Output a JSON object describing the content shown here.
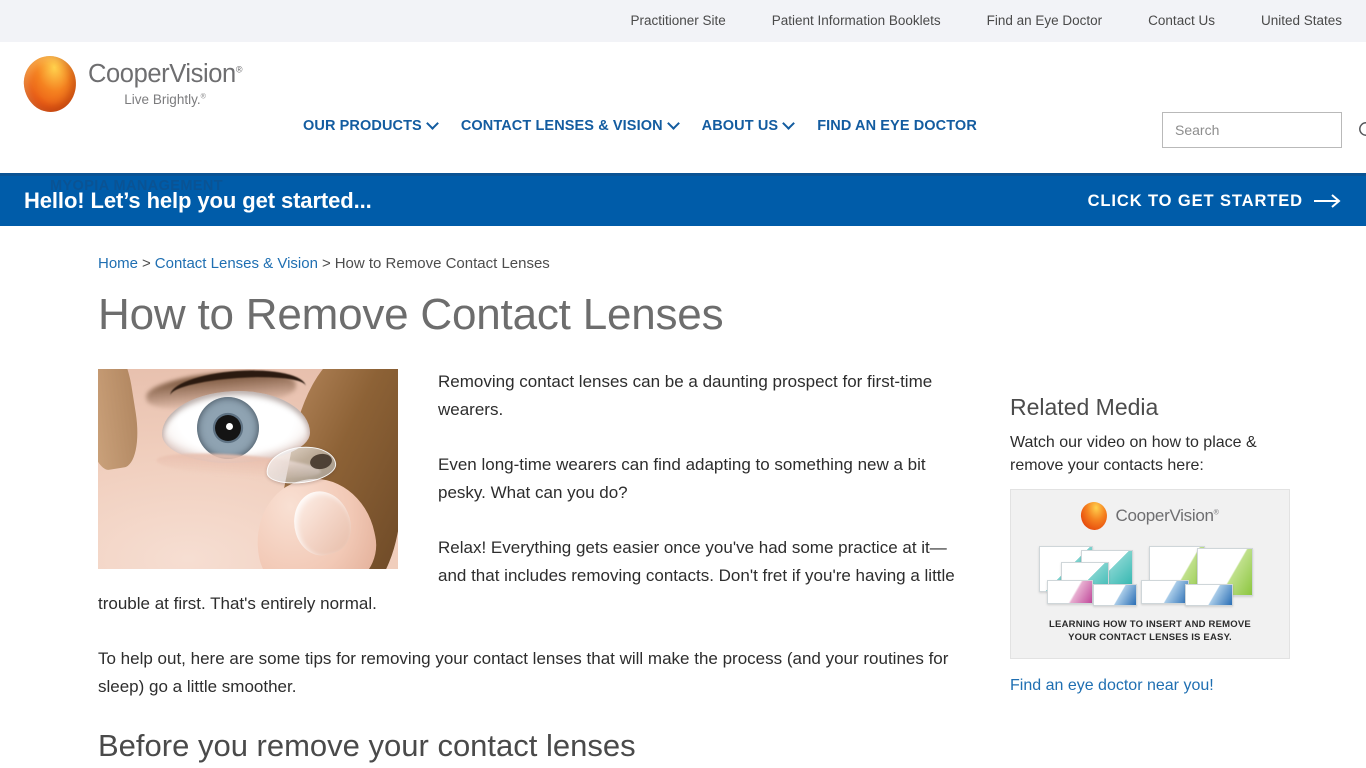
{
  "utility_bar": {
    "links": [
      {
        "label": "Practitioner Site",
        "name": "practitioner-site"
      },
      {
        "label": "Patient Information Booklets",
        "name": "patient-information-booklets"
      },
      {
        "label": "Find an Eye Doctor",
        "name": "find-an-eye-doctor"
      },
      {
        "label": "Contact Us",
        "name": "contact-us"
      },
      {
        "label": "United States",
        "name": "united-states"
      }
    ]
  },
  "header": {
    "logo": {
      "brand": "CooperVision",
      "brand_mark": "®",
      "tagline": "Live Brightly.",
      "tagline_mark": "®"
    },
    "sub_brand": "MYOPIA MANAGEMENT",
    "nav": [
      {
        "label": "OUR PRODUCTS",
        "has_dropdown": true
      },
      {
        "label": "CONTACT LENSES & VISION",
        "has_dropdown": true
      },
      {
        "label": "ABOUT US",
        "has_dropdown": true
      },
      {
        "label": "FIND AN EYE DOCTOR",
        "has_dropdown": false
      }
    ],
    "search": {
      "placeholder": "Search",
      "value": ""
    }
  },
  "cta_banner": {
    "message": "Hello! Let’s help you get started...",
    "action_label": "CLICK TO GET STARTED",
    "arrow": "→",
    "background": "#005ca9"
  },
  "breadcrumb": {
    "items": [
      {
        "label": "Home",
        "link": true
      },
      {
        "label": "Contact Lenses & Vision",
        "link": true
      },
      {
        "label": "How to Remove Contact Lenses",
        "link": false
      }
    ],
    "separator": ">"
  },
  "page": {
    "title": "How to Remove Contact Lenses",
    "paragraphs": [
      "Removing contact lenses can be a daunting prospect for first-time wearers.",
      "Even long-time wearers can find adapting to something new a bit pesky. What can you do?",
      "Relax! Everything gets easier once you've had some practice at it—and that includes removing contacts. Don't fret if you're having a little trouble at first. That's entirely normal.",
      "To help out, here are some tips for removing your contact lenses that will make the process (and your routines for sleep) go a little smoother."
    ],
    "next_heading": "Before you remove your contact lenses",
    "hero_image_alt": "Close-up of a woman's eye with a contact lens balanced on a fingertip"
  },
  "related_media": {
    "title": "Related Media",
    "description": "Watch our video on how to place & remove your contacts here:",
    "video_card": {
      "brand": "CooperVision",
      "brand_mark": "®",
      "caption_line1": "LEARNING HOW TO INSERT AND REMOVE",
      "caption_line2": "YOUR CONTACT LENSES IS EASY."
    },
    "link_label": "Find an eye doctor near you!"
  },
  "colors": {
    "brand_blue": "#005ca9",
    "nav_blue": "#135ca0",
    "link_blue": "#1f6fb2",
    "utility_bg": "#f2f3f7",
    "heading_gray": "#6d6d6d",
    "body_text": "#2d2d2d"
  }
}
